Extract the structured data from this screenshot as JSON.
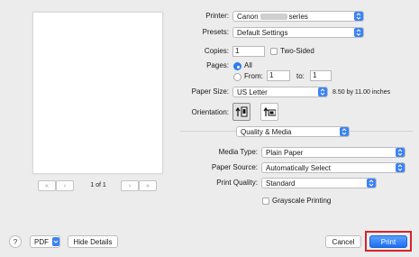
{
  "printer": {
    "label": "Printer:",
    "value_prefix": "Canon",
    "value_suffix": "series"
  },
  "presets": {
    "label": "Presets:",
    "value": "Default Settings"
  },
  "copies": {
    "label": "Copies:",
    "value": "1",
    "two_sided_label": "Two-Sided"
  },
  "pages": {
    "label": "Pages:",
    "all_label": "All",
    "from_label": "From:",
    "from_value": "1",
    "to_label": "to:",
    "to_value": "1"
  },
  "paper_size": {
    "label": "Paper Size:",
    "value": "US Letter",
    "dimensions": "8.50 by 11.00 inches"
  },
  "orientation": {
    "label": "Orientation:"
  },
  "section": {
    "value": "Quality & Media"
  },
  "media_type": {
    "label": "Media Type:",
    "value": "Plain Paper"
  },
  "paper_source": {
    "label": "Paper Source:",
    "value": "Automatically Select"
  },
  "print_quality": {
    "label": "Print Quality:",
    "value": "Standard"
  },
  "grayscale": {
    "label": "Grayscale Printing"
  },
  "preview": {
    "page_indicator": "1 of 1"
  },
  "footer": {
    "help_label": "?",
    "pdf_label": "PDF",
    "hide_details_label": "Hide Details",
    "cancel_label": "Cancel",
    "print_label": "Print"
  },
  "colors": {
    "accent": "#1d6ff2",
    "highlight_box": "#d9242a"
  }
}
